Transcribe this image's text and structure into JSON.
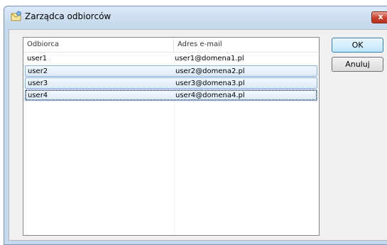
{
  "window": {
    "title": "Zarządca odbiorców",
    "close_label": "x"
  },
  "list": {
    "columns": [
      "Odbiorca",
      "Adres e-mail"
    ],
    "rows": [
      {
        "name": "user1",
        "email": "user1@domena1.pl"
      },
      {
        "name": "user2",
        "email": "user2@domena2.pl"
      },
      {
        "name": "user3",
        "email": "user3@domena3.pl"
      },
      {
        "name": "user4",
        "email": "user4@domena4.pl"
      }
    ]
  },
  "buttons": {
    "ok_label": "OK",
    "cancel_label": "Anuluj"
  },
  "colors": {
    "frame": "#c5d8ec",
    "selection_border": "#84acdd",
    "close_red": "#c7412d"
  },
  "icons": {
    "title": "envelope-contacts-icon",
    "close": "close-icon"
  }
}
